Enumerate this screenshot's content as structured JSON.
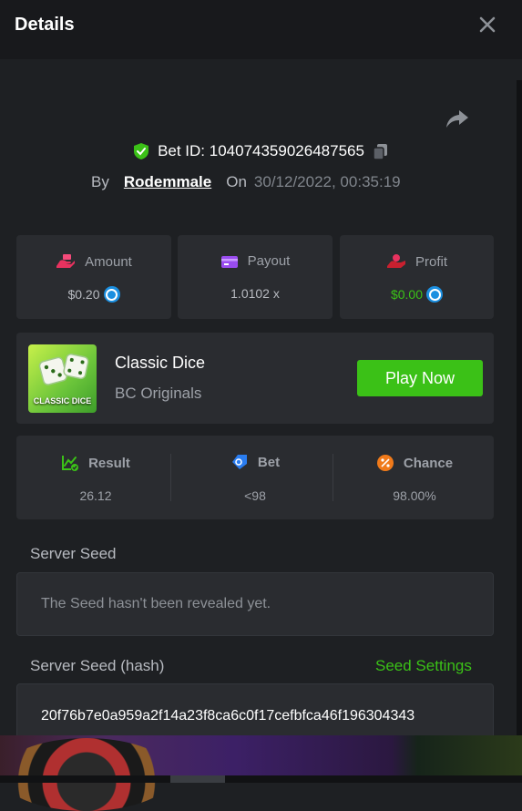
{
  "header": {
    "title": "Details"
  },
  "bet": {
    "id_label": "Bet ID: 104074359026487565",
    "by_label": "By",
    "username": "Rodemmale",
    "on_label": "On",
    "datetime": "30/12/2022, 00:35:19"
  },
  "stats": {
    "amount": {
      "label": "Amount",
      "value": "$0.20",
      "icon": "money-hand-icon"
    },
    "payout": {
      "label": "Payout",
      "value": "1.0102 x",
      "icon": "wallet-card-icon"
    },
    "profit": {
      "label": "Profit",
      "value": "$0.00",
      "icon": "profit-hand-icon"
    }
  },
  "game": {
    "thumb_label": "CLASSIC DICE",
    "name": "Classic Dice",
    "provider": "BC Originals",
    "play_label": "Play Now"
  },
  "result": {
    "result": {
      "label": "Result",
      "value": "26.12"
    },
    "bet": {
      "label": "Bet",
      "value": "<98"
    },
    "chance": {
      "label": "Chance",
      "value": "98.00%"
    }
  },
  "server_seed": {
    "label": "Server Seed",
    "value": "The Seed hasn't been revealed yet."
  },
  "server_seed_hash": {
    "label": "Server Seed (hash)",
    "settings_label": "Seed Settings",
    "value": "20f76b7e0a959a2f14a23f8ca6c0f17cefbfca46f196304343"
  },
  "colors": {
    "accent_green": "#3bc117",
    "panel": "#2a2c30",
    "background": "#1e2023",
    "coin_blue": "#1b8fe0"
  }
}
